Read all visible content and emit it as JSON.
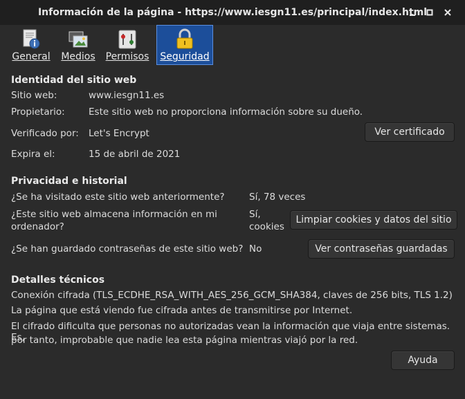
{
  "window": {
    "title": "Información de la página - https://www.iesgn11.es/principal/index.html"
  },
  "tabs": [
    {
      "label": "General",
      "icon": "document-info-icon"
    },
    {
      "label": "Medios",
      "icon": "media-icon"
    },
    {
      "label": "Permisos",
      "icon": "permissions-icon"
    },
    {
      "label": "Seguridad",
      "icon": "padlock-icon",
      "active": true
    }
  ],
  "identity": {
    "heading": "Identidad del sitio web",
    "website_label": "Sitio web:",
    "website_value": "www.iesgn11.es",
    "owner_label": "Propietario:",
    "owner_value": "Este sitio web no proporciona información sobre su dueño.",
    "verified_label": "Verificado por:",
    "verified_value": "Let's Encrypt",
    "expires_label": "Expira el:",
    "expires_value": "15 de abril de 2021",
    "view_cert_button": "Ver certificado"
  },
  "privacy": {
    "heading": "Privacidad e historial",
    "visited_question": "¿Se ha visitado este sitio web anteriormente?",
    "visited_answer": "Sí, 78 veces",
    "stores_question_line1": "¿Este sitio web almacena información en mi",
    "stores_question_line2": "ordenador?",
    "stores_answer_line1": "Sí,",
    "stores_answer_line2": "cookies",
    "clear_cookies_button": "Limpiar cookies y datos del sitio",
    "passwords_question": "¿Se han guardado contraseñas de este sitio web?",
    "passwords_answer": "No",
    "view_passwords_button": "Ver contraseñas guardadas"
  },
  "technical": {
    "heading": "Detalles técnicos",
    "line1": "Conexión cifrada (TLS_ECDHE_RSA_WITH_AES_256_GCM_SHA384, claves de 256 bits, TLS 1.2)",
    "line2": "La página que está viendo fue cifrada antes de transmitirse por Internet.",
    "line3": "El cifrado dificulta que personas no autorizadas vean la información que viaja entre sistemas. Es,",
    "line4": "por tanto, improbable que nadie lea esta página mientras viajó por la red."
  },
  "help_button": "Ayuda",
  "colors": {
    "background": "#2b2b2b",
    "titlebar": "#1f1f1f",
    "active_tab": "#1c4e9a",
    "button": "#353535"
  }
}
